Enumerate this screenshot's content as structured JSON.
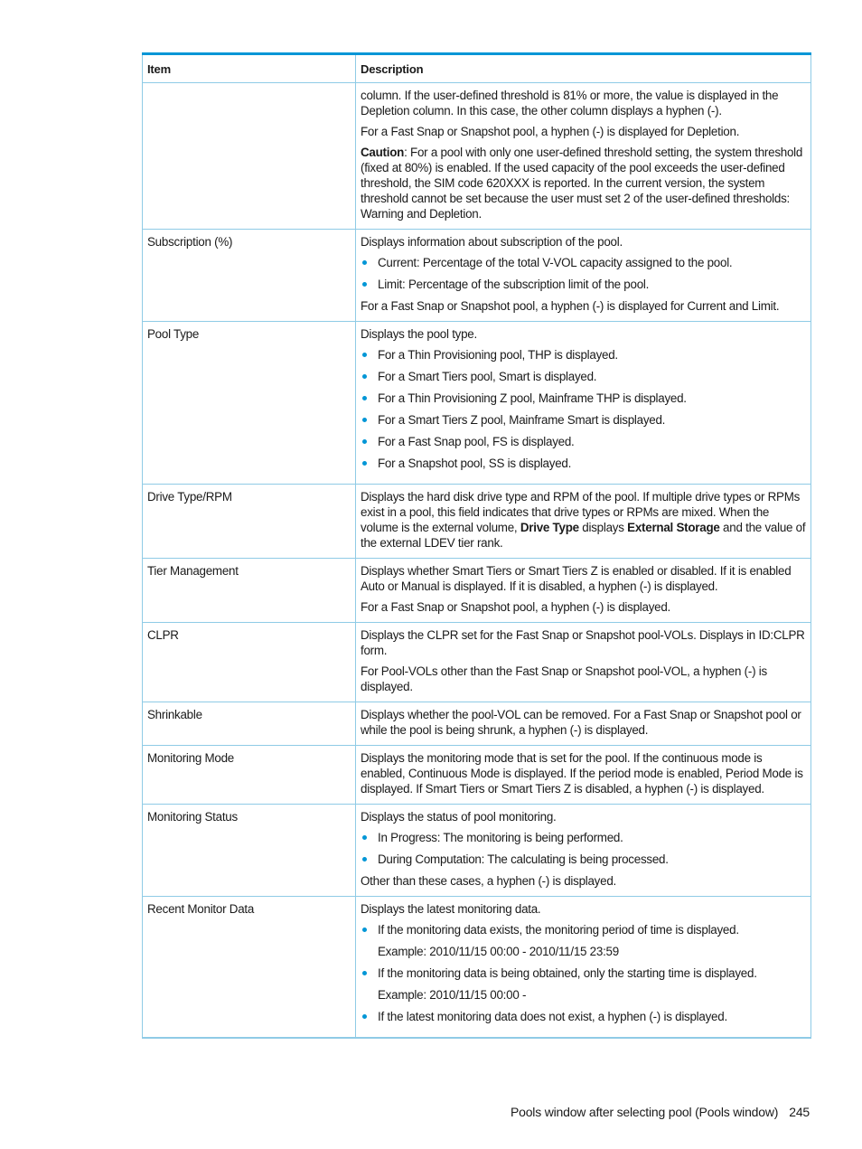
{
  "table": {
    "headers": {
      "item": "Item",
      "description": "Description"
    },
    "rows": [
      {
        "item": "",
        "p1": "column. If the user-defined threshold is 81% or more, the value is displayed in the Depletion column. In this case, the other column displays a hyphen (-).",
        "p2": "For a Fast Snap or Snapshot pool, a hyphen (-) is displayed for Depletion.",
        "caution_label": "Caution",
        "caution_text": ": For a pool with only one user-defined threshold setting, the system threshold (fixed at 80%) is enabled. If the used capacity of the pool exceeds the user-defined threshold, the SIM code 620XXX is reported. In the current version, the system threshold cannot be set because the user must set 2 of the user-defined thresholds: Warning and Depletion."
      },
      {
        "item": "Subscription (%)",
        "intro": "Displays information about subscription of the pool.",
        "bullets": [
          "Current: Percentage of the total V-VOL capacity assigned to the pool.",
          "Limit: Percentage of the subscription limit of the pool."
        ],
        "note": "For a Fast Snap or Snapshot pool, a hyphen (-) is displayed for Current and Limit."
      },
      {
        "item": "Pool Type",
        "intro": "Displays the pool type.",
        "bullets": [
          "For a Thin Provisioning pool, THP is displayed.",
          "For a Smart Tiers pool, Smart is displayed.",
          "For a Thin Provisioning Z pool, Mainframe THP is displayed.",
          "For a Smart Tiers Z pool, Mainframe Smart is displayed.",
          "For a Fast Snap pool, FS is displayed.",
          "For a Snapshot pool, SS is displayed."
        ]
      },
      {
        "item": "Drive Type/RPM",
        "t1": "Displays the hard disk drive type and RPM of the pool. If multiple drive types or RPMs exist in a pool, this field indicates that drive types or RPMs are mixed. When the volume is the external volume, ",
        "b1": "Drive Type",
        "t2": " displays ",
        "b2": "External Storage",
        "t3": " and the value of the external LDEV tier rank."
      },
      {
        "item": "Tier Management",
        "p1": "Displays whether Smart Tiers or Smart Tiers Z is enabled or disabled. If it is enabled Auto or Manual is displayed. If it is disabled, a hyphen (-) is displayed.",
        "p2": "For a Fast Snap or Snapshot pool, a hyphen (-) is displayed."
      },
      {
        "item": "CLPR",
        "p1": "Displays the CLPR set for the Fast Snap or Snapshot pool-VOLs. Displays in ID:CLPR form.",
        "p2": "For Pool-VOLs other than the Fast Snap or Snapshot pool-VOL, a hyphen (-) is displayed."
      },
      {
        "item": "Shrinkable",
        "p1": "Displays whether the pool-VOL can be removed. For a Fast Snap or Snapshot pool or while the pool is being shrunk, a hyphen (-) is displayed."
      },
      {
        "item": "Monitoring Mode",
        "p1": "Displays the monitoring mode that is set for the pool. If the continuous mode is enabled, Continuous Mode is displayed. If the period mode is enabled, Period Mode is displayed. If Smart Tiers or Smart Tiers Z is disabled, a hyphen (-) is displayed."
      },
      {
        "item": "Monitoring Status",
        "intro": "Displays the status of pool monitoring.",
        "bullets": [
          "In Progress: The monitoring is being performed.",
          "During Computation: The calculating is being processed."
        ],
        "note": "Other than these cases, a hyphen (-) is displayed."
      },
      {
        "item": "Recent Monitor Data",
        "intro": "Displays the latest monitoring data.",
        "bullets": [
          {
            "text": "If the monitoring data exists, the monitoring period of time is displayed.",
            "example": "Example: 2010/11/15 00:00 - 2010/11/15 23:59"
          },
          {
            "text": "If the monitoring data is being obtained, only the starting time is displayed.",
            "example": "Example: 2010/11/15 00:00 -"
          },
          {
            "text": "If the latest monitoring data does not exist, a hyphen (-) is displayed."
          }
        ]
      }
    ]
  },
  "footer": {
    "title": "Pools window after selecting pool (Pools window)",
    "page_number": "245"
  },
  "colors": {
    "accent_rule": "#0096d6",
    "cell_border": "#8fcbe6",
    "bullet": "#0096d6"
  }
}
